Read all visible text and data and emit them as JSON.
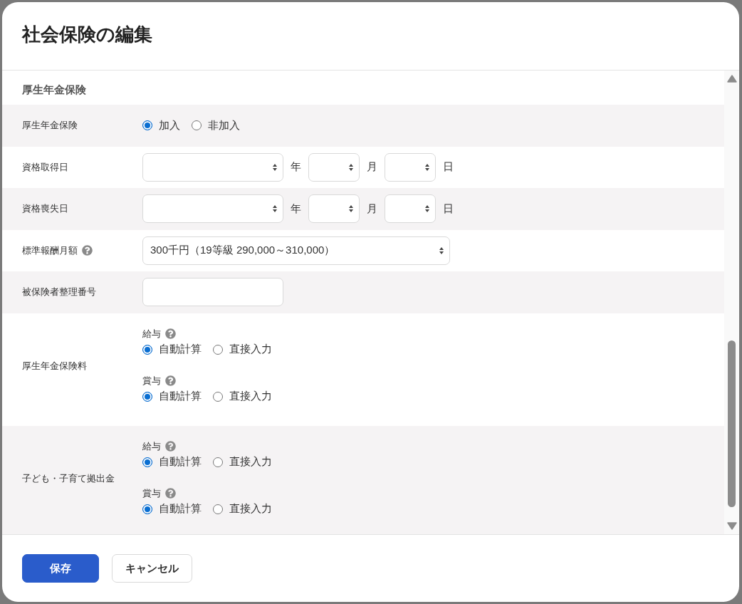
{
  "dialog": {
    "title": "社会保険の編集"
  },
  "section": {
    "title": "厚生年金保険"
  },
  "rows": [
    {
      "kind": "radio",
      "label": "厚生年金保険",
      "options": [
        {
          "label": "加入",
          "selected": true
        },
        {
          "label": "非加入",
          "selected": false
        }
      ]
    },
    {
      "kind": "date",
      "label": "資格取得日",
      "parts": [
        {
          "unit": "年"
        },
        {
          "unit": "月"
        },
        {
          "unit": "日"
        }
      ]
    },
    {
      "kind": "date",
      "label": "資格喪失日",
      "parts": [
        {
          "unit": "年"
        },
        {
          "unit": "月"
        },
        {
          "unit": "日"
        }
      ]
    },
    {
      "kind": "select",
      "label": "標準報酬月額",
      "help": true,
      "value": "300千円（19等級 290,000～310,000）"
    },
    {
      "kind": "input",
      "label": "被保険者整理番号"
    },
    {
      "kind": "radio_groups",
      "label": "厚生年金保険料",
      "groups": [
        {
          "label": "給与",
          "help": true,
          "options": [
            {
              "label": "自動計算",
              "selected": true
            },
            {
              "label": "直接入力",
              "selected": false
            }
          ]
        },
        {
          "label": "賞与",
          "help": true,
          "options": [
            {
              "label": "自動計算",
              "selected": true
            },
            {
              "label": "直接入力",
              "selected": false
            }
          ]
        }
      ]
    },
    {
      "kind": "radio_groups",
      "label": "子ども・子育て拠出金",
      "groups": [
        {
          "label": "給与",
          "help": true,
          "options": [
            {
              "label": "自動計算",
              "selected": true
            },
            {
              "label": "直接入力",
              "selected": false
            }
          ]
        },
        {
          "label": "賞与",
          "help": true,
          "options": [
            {
              "label": "自動計算",
              "selected": true
            },
            {
              "label": "直接入力",
              "selected": false
            }
          ]
        }
      ]
    }
  ],
  "buttons": [
    {
      "kind": "primary",
      "label": "保存"
    },
    {
      "kind": "secondary",
      "label": "キャンセル"
    }
  ]
}
